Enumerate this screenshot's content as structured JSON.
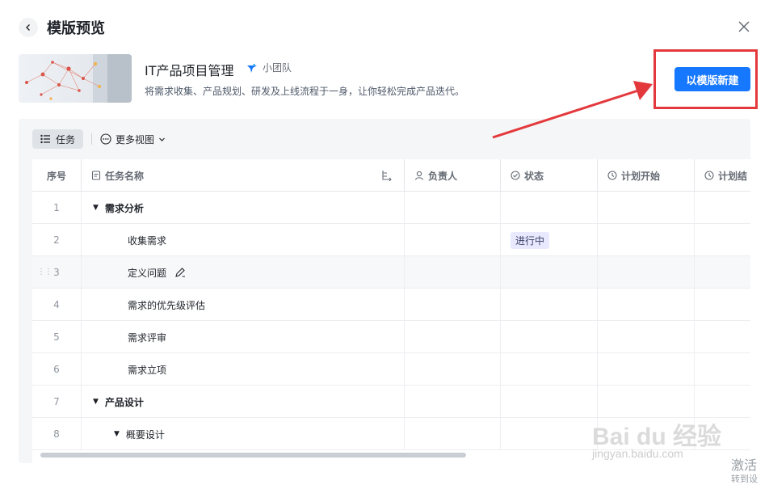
{
  "dialog": {
    "title": "模版预览"
  },
  "template": {
    "name": "IT产品项目管理",
    "tag": "小团队",
    "description": "将需求收集、产品规划、研发及上线流程于一身，让你轻松完成产品迭代。",
    "create_button": "以模版新建"
  },
  "toolbar": {
    "task_view": "任务",
    "more_views": "更多视图"
  },
  "table": {
    "columns": {
      "seq": "序号",
      "name": "任务名称",
      "owner": "负责人",
      "status": "状态",
      "plan_start": "计划开始",
      "plan_end": "计划结"
    },
    "rows": [
      {
        "seq": "1",
        "name": "需求分析",
        "level": 0,
        "group": true,
        "status": ""
      },
      {
        "seq": "2",
        "name": "收集需求",
        "level": 2,
        "group": false,
        "status": "进行中"
      },
      {
        "seq": "3",
        "name": "定义问题",
        "level": 2,
        "group": false,
        "status": ""
      },
      {
        "seq": "4",
        "name": "需求的优先级评估",
        "level": 2,
        "group": false,
        "status": ""
      },
      {
        "seq": "5",
        "name": "需求评审",
        "level": 2,
        "group": false,
        "status": ""
      },
      {
        "seq": "6",
        "name": "需求立项",
        "level": 2,
        "group": false,
        "status": ""
      },
      {
        "seq": "7",
        "name": "产品设计",
        "level": 0,
        "group": true,
        "status": ""
      },
      {
        "seq": "8",
        "name": "概要设计",
        "level": 1,
        "group": true,
        "status": ""
      }
    ]
  },
  "watermark": {
    "logo": "Bai du 经验",
    "url": "jingyan.baidu.com"
  },
  "activation": {
    "line1": "激活",
    "line2": "转到设"
  },
  "colors": {
    "primary": "#1677ff",
    "highlight": "#e3393c",
    "status_tag_bg": "#e8e9ff"
  }
}
